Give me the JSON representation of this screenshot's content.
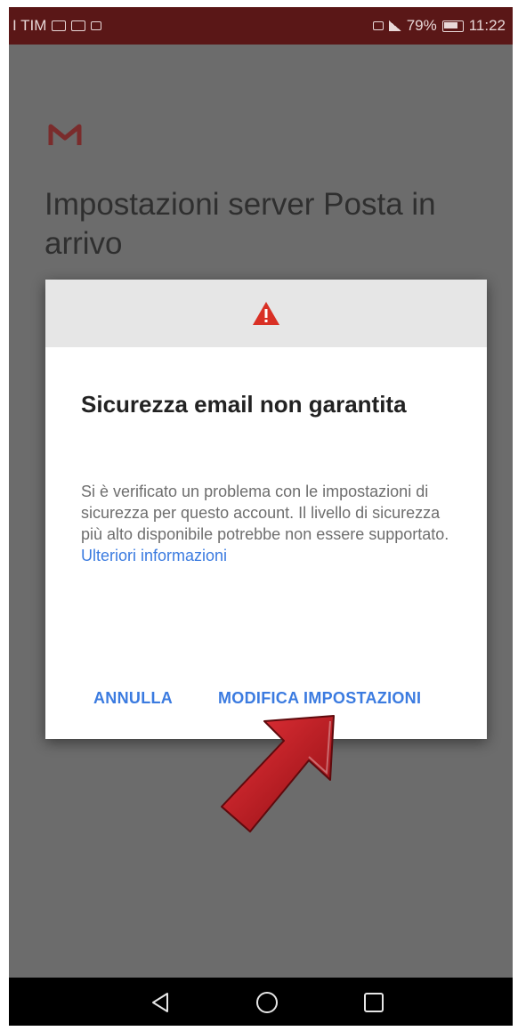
{
  "status_bar": {
    "carrier": "I TIM",
    "battery_percent": "79%",
    "time": "11:22",
    "color": "#5a1717"
  },
  "app": {
    "logo_icon": "gmail-m-icon",
    "screen_title": "Impostazioni server Posta in arrivo"
  },
  "dialog": {
    "header_icon": "warning-triangle-icon",
    "title": "Sicurezza email non garantita",
    "body": "Si è verificato un problema con le impostazioni di sicurezza per questo account. Il livello di sicurezza più alto disponibile potrebbe non essere supportato.",
    "learn_more_link": "Ulteriori informazioni",
    "cancel_label": "ANNULLA",
    "modify_label": "MODIFICA IMPOSTAZIONI",
    "accent_color": "#3b7be0",
    "warning_color": "#d93025"
  },
  "annotation": {
    "icon": "red-pointer-arrow-icon",
    "color": "#c0141c"
  },
  "nav_bar": {
    "back_icon": "back-triangle-icon",
    "home_icon": "home-circle-icon",
    "recent_icon": "recent-apps-square-icon"
  }
}
